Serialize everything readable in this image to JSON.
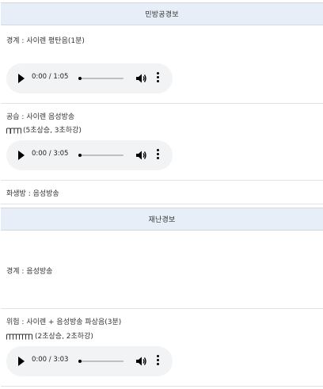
{
  "civil_defense": {
    "title": "민방공경보",
    "alert": {
      "label": "경계 : 사이렌 평탄음(1분)",
      "player_time": "0:00 / 1:05"
    },
    "air_raid": {
      "label": "공습 : 사이렌 음성방송",
      "pattern": "(5초상승, 3초하강)",
      "player_time": "0:00 / 3:05"
    },
    "cbr": {
      "label": "화생방 : 음성방송"
    }
  },
  "disaster": {
    "title": "재난경보",
    "alert": {
      "label": "경계 : 음성방송"
    },
    "danger": {
      "label": "위험 : 사이렌 + 음성방송 파상음(3분)",
      "pattern": "(2초상승, 2초하강)",
      "player_time": "0:00 / 3:03"
    }
  },
  "icons": {
    "play": "play-icon",
    "volume": "volume-icon",
    "more": "more-vert-icon",
    "wave": "siren-wave-icon"
  }
}
